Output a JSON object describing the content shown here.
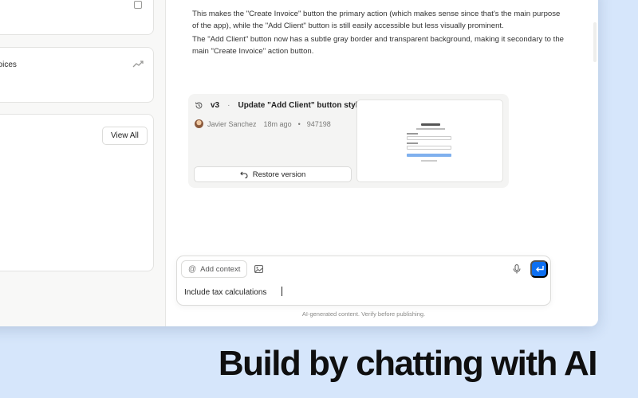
{
  "left_pane": {
    "invoices_card_label": "nvoices",
    "view_all_label": "View All"
  },
  "chat": {
    "message_1": "This makes the \"Create Invoice\" button the primary action (which makes sense since that's the main purpose of the app), while the \"Add Client\" button is still easily accessible but less visually prominent.",
    "message_2": "The \"Add Client\" button now has a subtle gray border and transparent background, making it secondary to the main \"Create Invoice\" action button."
  },
  "version_card": {
    "version": "v3",
    "separator": "·",
    "title": "Update \"Add Client\" button style",
    "author": "Javier Sanchez",
    "time_ago": "18m ago",
    "bullet": "•",
    "commit": "947198",
    "restore_label": "Restore version"
  },
  "composer": {
    "add_context_label": "Add context",
    "input_value": "Include tax calculations",
    "disclaimer": "AI-generated content. Verify before publishing."
  },
  "tagline": "Build by chatting with AI",
  "colors": {
    "background": "#d6e6fb",
    "accent": "#0c6ff2"
  }
}
